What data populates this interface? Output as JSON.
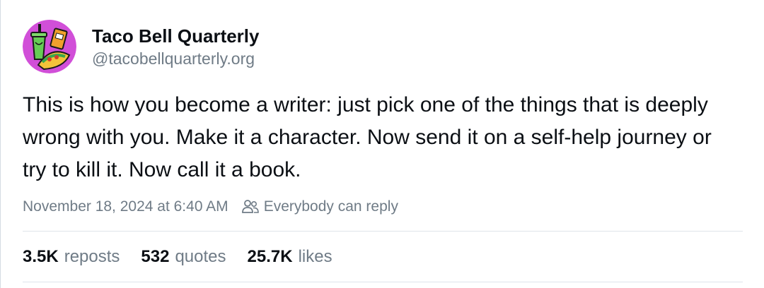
{
  "author": {
    "display_name": "Taco Bell Quarterly",
    "handle": "@tacobellquarterly.org",
    "avatar_icon": "taco-bell-quarterly-logo-icon"
  },
  "post": {
    "text": "This is how you become a writer: just pick one of the things that is deeply wrong with you. Make it a character. Now send it on a self-help journey or try to kill it. Now call it a book.",
    "timestamp": "November 18, 2024 at 6:40 AM",
    "reply_setting": "Everybody can reply",
    "reply_setting_icon": "people-icon"
  },
  "stats": {
    "reposts": {
      "count": "3.5K",
      "label": "reposts"
    },
    "quotes": {
      "count": "532",
      "label": "quotes"
    },
    "likes": {
      "count": "25.7K",
      "label": "likes"
    }
  },
  "colors": {
    "text_primary": "#0b0f14",
    "text_secondary": "#6f7b86",
    "divider": "#dfe4ea",
    "avatar_bg": "#d14fd8"
  }
}
